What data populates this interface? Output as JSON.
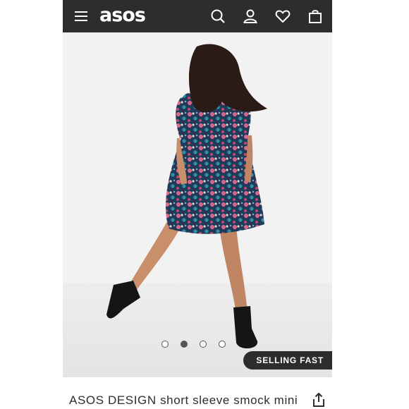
{
  "header": {
    "logo": "asos",
    "menu_icon": "hamburger-menu-icon",
    "search_icon": "search-icon",
    "account_icon": "user-icon",
    "wishlist_icon": "heart-icon",
    "bag_icon": "shopping-bag-icon",
    "background": "#2d2d2d"
  },
  "gallery": {
    "image_count": 4,
    "active_index": 1,
    "badge": "SELLING FAST"
  },
  "product": {
    "title": "ASOS DESIGN short sleeve smock mini",
    "share_icon": "share-icon"
  }
}
